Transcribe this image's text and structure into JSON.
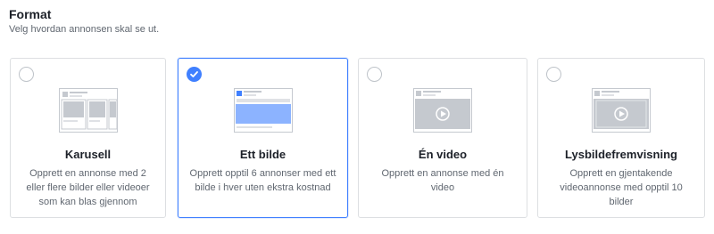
{
  "header": {
    "title": "Format",
    "subtitle": "Velg hvordan annonsen skal se ut."
  },
  "colors": {
    "accent": "#4080ff",
    "border": "#dddfe2",
    "thumb_gray": "#c5c9cf",
    "thumb_blue": "#8cb3ff"
  },
  "cards": [
    {
      "title": "Karusell",
      "description": "Opprett en annonse med 2 eller flere bilder eller videoer som kan blas gjennom",
      "selected": false,
      "icon": "carousel-thumbnail-icon"
    },
    {
      "title": "Ett bilde",
      "description": "Opprett opptil 6 annonser med ett bilde i hver uten ekstra kostnad",
      "selected": true,
      "icon": "single-image-thumbnail-icon"
    },
    {
      "title": "Én video",
      "description": "Opprett en annonse med én video",
      "selected": false,
      "icon": "single-video-thumbnail-icon"
    },
    {
      "title": "Lysbildefremvisning",
      "description": "Opprett en gjentakende videoannonse med opptil 10 bilder",
      "selected": false,
      "icon": "slideshow-thumbnail-icon"
    }
  ]
}
